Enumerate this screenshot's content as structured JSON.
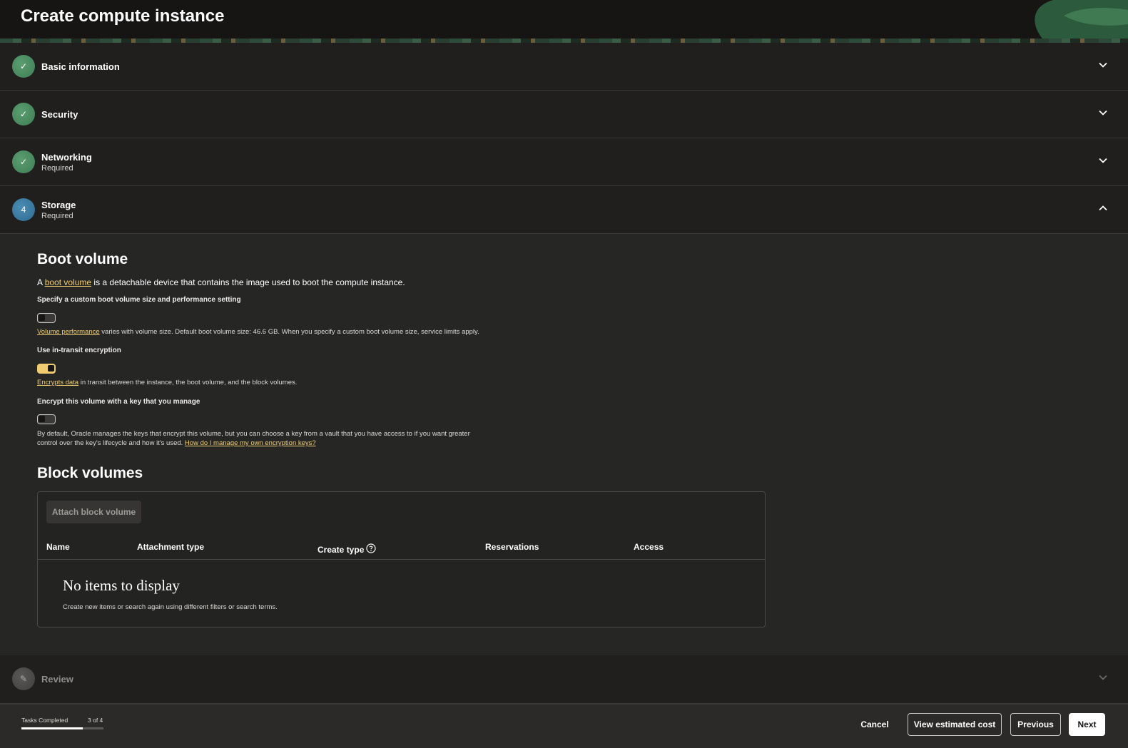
{
  "header": {
    "title": "Create compute instance"
  },
  "sections": {
    "basic": {
      "title": "Basic information",
      "badge": "✓"
    },
    "security": {
      "title": "Security",
      "badge": "✓"
    },
    "networking": {
      "title": "Networking",
      "subtitle": "Required",
      "badge": "✓"
    },
    "storage": {
      "title": "Storage",
      "subtitle": "Required",
      "badge": "4"
    },
    "review": {
      "title": "Review",
      "badge": "✎"
    }
  },
  "boot_volume": {
    "heading": "Boot volume",
    "intro_prefix": "A ",
    "intro_link": "boot volume",
    "intro_suffix": " is a detachable device that contains the image used to boot the compute instance.",
    "custom_size": {
      "label": "Specify a custom boot volume size and performance setting",
      "enabled": false,
      "help_link": "Volume performance",
      "help_text": " varies with volume size. Default boot volume size: 46.6 GB. When you specify a custom boot volume size, service limits apply."
    },
    "in_transit": {
      "label": "Use in-transit encryption",
      "enabled": true,
      "help_link": "Encrypts data",
      "help_text": " in transit between the instance, the boot volume, and the block volumes."
    },
    "own_key": {
      "label": "Encrypt this volume with a key that you manage",
      "enabled": false,
      "help_text_line1": "By default, Oracle manages the keys that encrypt this volume, but you can choose a key from a vault that you have access to if you want greater",
      "help_text_line2": "control over the key's lifecycle and how it's used. ",
      "help_link": "How do I manage my own encryption keys?"
    }
  },
  "block_volumes": {
    "heading": "Block volumes",
    "attach_label": "Attach block volume",
    "columns": [
      "Name",
      "Attachment type",
      "Create type",
      "Reservations",
      "Access"
    ],
    "empty_title": "No items to display",
    "empty_subtitle": "Create new items or search again using different filters or search terms."
  },
  "footer": {
    "tasks_label": "Tasks Completed",
    "tasks_count": "3 of 4",
    "progress_fraction": 0.75,
    "cancel": "Cancel",
    "estimate": "View estimated cost",
    "previous": "Previous",
    "next": "Next"
  },
  "colors": {
    "accent_link": "#f0cc71",
    "badge_done": "#4e8f62",
    "badge_current": "#3f7ea4"
  }
}
